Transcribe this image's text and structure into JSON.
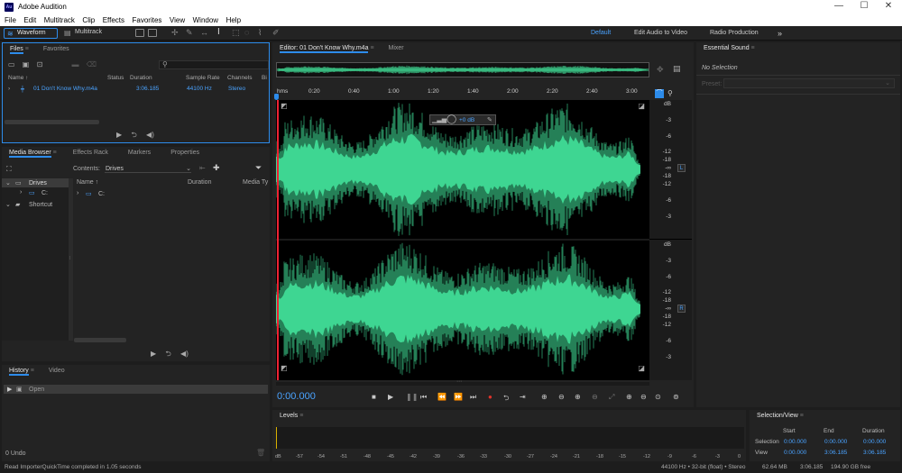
{
  "app": {
    "title": "Adobe Audition",
    "logo_text": "Au",
    "window_controls": [
      "—",
      "☐",
      "✕"
    ]
  },
  "menu": [
    "File",
    "Edit",
    "Multitrack",
    "Clip",
    "Effects",
    "Favorites",
    "View",
    "Window",
    "Help"
  ],
  "toolbar": {
    "waveform_label": "Waveform",
    "multitrack_label": "Multitrack",
    "workspaces": [
      "Default",
      "Edit Audio to Video",
      "Radio Production"
    ],
    "more": "»"
  },
  "files_panel": {
    "tabs": [
      "Files",
      "Favorites"
    ],
    "columns": [
      "Name ↑",
      "Status",
      "Duration",
      "Sample Rate",
      "Channels",
      "Bi"
    ],
    "rows": [
      {
        "name": "01 Don't Know Why.m4a",
        "status": "",
        "duration": "3:06.185",
        "sample_rate": "44100 Hz",
        "channels": "Stereo"
      }
    ]
  },
  "media_browser": {
    "tabs": [
      "Media Browser",
      "Effects Rack",
      "Markers",
      "Properties"
    ],
    "contents_label": "Contents:",
    "contents_value": "Drives",
    "tree": [
      "Drives",
      "C:",
      "Shortcut"
    ],
    "columns": [
      "Name ↑",
      "Duration",
      "Media Ty"
    ],
    "rows": [
      "C:"
    ]
  },
  "history_panel": {
    "tabs": [
      "History",
      "Video"
    ],
    "items": [
      "Open"
    ],
    "undo_count": "0 Undo"
  },
  "editor": {
    "tabs": [
      "Editor: 01 Don't Know Why.m4a",
      "Mixer"
    ],
    "ruler": [
      "hms",
      "0:20",
      "0:40",
      "1:00",
      "1:20",
      "1:40",
      "2:00",
      "2:20",
      "2:40",
      "3:00"
    ],
    "db_unit": "dB",
    "db_scale": [
      "-3",
      "-6",
      "-12",
      "-18",
      "-∞",
      "-18",
      "-12",
      "-6",
      "-3"
    ],
    "channel_labels": [
      "L",
      "R"
    ],
    "hud_gain": "+0 dB",
    "time": "0:00.000",
    "waveform_color": "#3fd692"
  },
  "levels": {
    "title": "Levels",
    "scale": [
      "dB",
      "-57",
      "-54",
      "-51",
      "-48",
      "-45",
      "-42",
      "-39",
      "-36",
      "-33",
      "-30",
      "-27",
      "-24",
      "-21",
      "-18",
      "-15",
      "-12",
      "-9",
      "-6",
      "-3",
      "0"
    ]
  },
  "essential_sound": {
    "title": "Essential Sound",
    "no_selection": "No Selection",
    "preset_label": "Preset:"
  },
  "selection_view": {
    "title": "Selection/View",
    "headers": [
      "Start",
      "End",
      "Duration"
    ],
    "selection_label": "Selection",
    "view_label": "View",
    "selection": [
      "0:00.000",
      "0:00.000",
      "0:00.000"
    ],
    "view": [
      "0:00.000",
      "3:06.185",
      "3:06.185"
    ]
  },
  "status_bar": {
    "message": "Read ImporterQuickTime completed in 1.05 seconds",
    "format": "44100 Hz • 32-bit (float) • Stereo",
    "size": "62.64 MB",
    "duration": "3:06.185",
    "free": "194.90 GB free"
  },
  "colors": {
    "accent": "#2d8ceb",
    "waveform": "#3fd692",
    "playhead": "#2d8ceb",
    "record": "#e0332b"
  }
}
